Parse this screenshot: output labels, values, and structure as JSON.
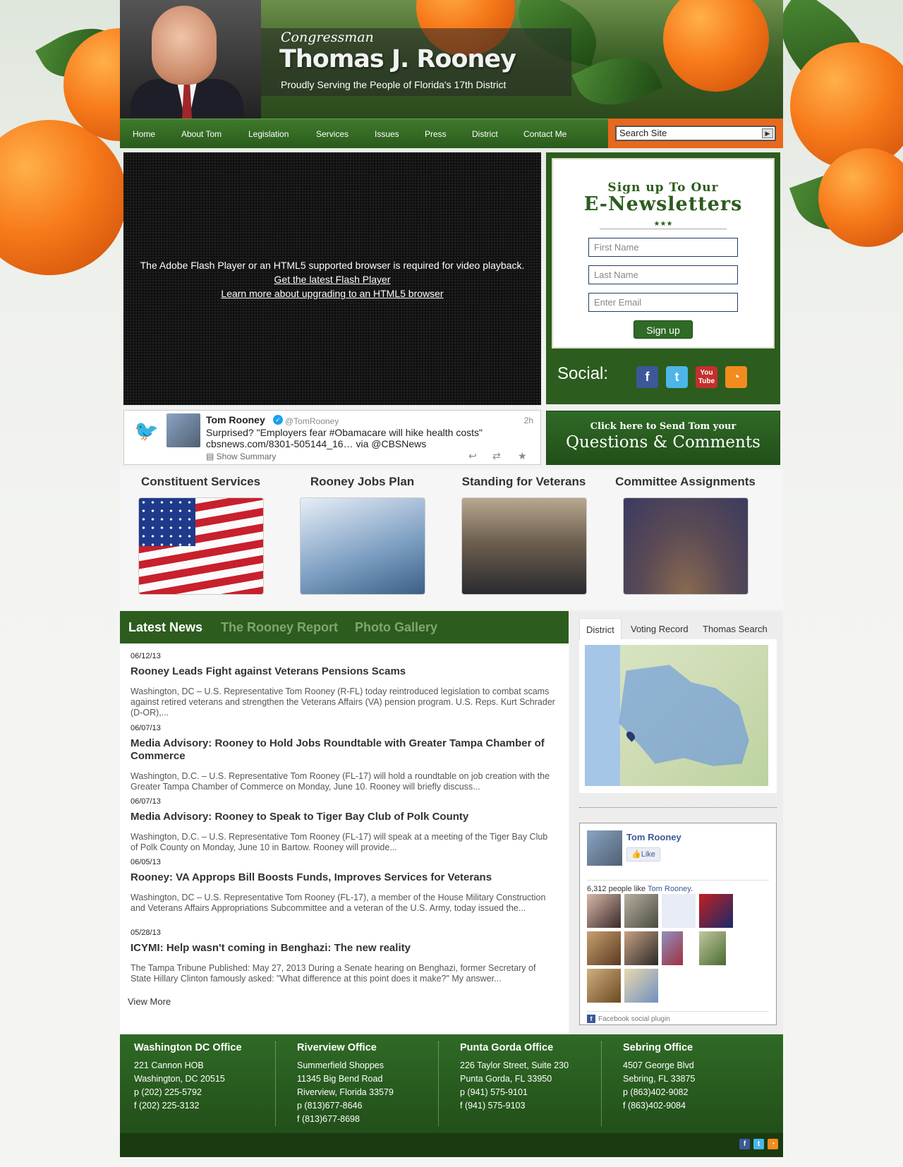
{
  "header": {
    "label": "Congressman",
    "name": "Thomas J. Rooney",
    "subtitle": "Proudly Serving the People of Florida's 17th District"
  },
  "nav": {
    "items": [
      "Home",
      "About Tom",
      "Legislation",
      "Services",
      "Issues",
      "Press",
      "District",
      "Contact Me"
    ]
  },
  "search": {
    "placeholder": "Search Site",
    "button_icon": "arrow-right-icon"
  },
  "video": {
    "message": "The Adobe Flash Player or an HTML5 supported browser is required for video playback.",
    "link1": "Get the latest Flash Player",
    "link2": "Learn more about upgrading to an HTML5 browser"
  },
  "newsletter": {
    "line1": "Sign up To Our",
    "line2": "E-Newsletters",
    "first_name": "First Name",
    "last_name": "Last Name",
    "email": "Enter Email",
    "button": "Sign up",
    "social_label": "Social:",
    "social_icons": [
      "facebook-icon",
      "twitter-icon",
      "youtube-icon",
      "rss-icon"
    ]
  },
  "tweet": {
    "name": "Tom Rooney",
    "handle": "@TomRooney",
    "time": "2h",
    "text": "Surprised? \"Employers fear #Obamacare will hike health costs\" cbsnews.com/8301-505144_16… via @CBSNews",
    "summary": "Show Summary"
  },
  "questions": {
    "line1": "Click here to Send Tom your",
    "line2": "Questions & Comments"
  },
  "features": [
    {
      "title": "Constituent Services",
      "image": "american-flag"
    },
    {
      "title": "Rooney Jobs Plan",
      "image": "calculator-coins"
    },
    {
      "title": "Standing for Veterans",
      "image": "veterans-group"
    },
    {
      "title": "Committee Assignments",
      "image": "capitol-rotunda"
    }
  ],
  "news": {
    "tabs": [
      "Latest News",
      "The Rooney Report",
      "Photo Gallery"
    ],
    "items": [
      {
        "date": "06/12/13",
        "title": "Rooney Leads Fight against Veterans Pensions Scams",
        "excerpt": "Washington, DC – U.S. Representative Tom Rooney (R-FL) today reintroduced legislation to combat scams against retired veterans and strengthen the Veterans Affairs (VA) pension program. U.S. Reps. Kurt Schrader (D-OR),..."
      },
      {
        "date": "06/07/13",
        "title": "Media Advisory: Rooney to Hold Jobs Roundtable with Greater Tampa Chamber of Commerce",
        "excerpt": "Washington, D.C. – U.S. Representative Tom Rooney (FL-17) will hold a roundtable on job creation with the Greater Tampa Chamber of Commerce on Monday, June 10. Rooney will briefly discuss..."
      },
      {
        "date": "06/07/13",
        "title": "Media Advisory: Rooney to Speak to Tiger Bay Club of Polk County",
        "excerpt": "Washington, D.C. – U.S. Representative Tom Rooney (FL-17) will speak at a meeting of the Tiger Bay Club of Polk County on Monday, June 10 in Bartow. Rooney will provide..."
      },
      {
        "date": "06/05/13",
        "title": "Rooney: VA Approps Bill Boosts Funds, Improves Services for Veterans",
        "excerpt": "Washington, DC – U.S. Representative Tom Rooney (FL-17), a member of the House Military Construction and Veterans Affairs Appropriations Subcommittee and a veteran of the U.S. Army, today issued the..."
      },
      {
        "date": "05/28/13",
        "title": "ICYMI: Help wasn't coming in Benghazi: The new reality",
        "excerpt": "The Tampa Tribune Published: May 27, 2013 During a Senate hearing on Benghazi, former Secretary of State Hillary Clinton famously asked: \"What difference at this point does it make?\" My answer..."
      }
    ],
    "view_more": "View More"
  },
  "sidebar": {
    "tabs": [
      "District",
      "Voting Record",
      "Thomas Search"
    ],
    "fb": {
      "name": "Tom Rooney",
      "like": "Like",
      "count_prefix": "6,312 people like",
      "count_name": "Tom Rooney",
      "count_suffix": ".",
      "plugin": "Facebook social plugin"
    }
  },
  "offices": [
    {
      "name": "Washington DC Office",
      "lines": [
        "221 Cannon HOB",
        "Washington, DC 20515",
        "p (202) 225-5792",
        "f (202) 225-3132"
      ]
    },
    {
      "name": "Riverview Office",
      "lines": [
        "Summerfield Shoppes",
        "11345 Big Bend Road",
        "Riverview, Florida 33579",
        "p (813)677-8646",
        "f (813)677-8698"
      ]
    },
    {
      "name": "Punta Gorda Office",
      "lines": [
        "226 Taylor Street, Suite 230",
        "Punta Gorda, FL 33950",
        "p (941) 575-9101",
        "f (941) 575-9103"
      ]
    },
    {
      "name": "Sebring Office",
      "lines": [
        "4507 George Blvd",
        "Sebring, FL 33875",
        "p (863)402-9082",
        "f (863)402-9084"
      ]
    }
  ],
  "colors": {
    "brand_green": "#2c5c1e",
    "accent_orange": "#e8681c",
    "link_blue": "#3b5998"
  }
}
